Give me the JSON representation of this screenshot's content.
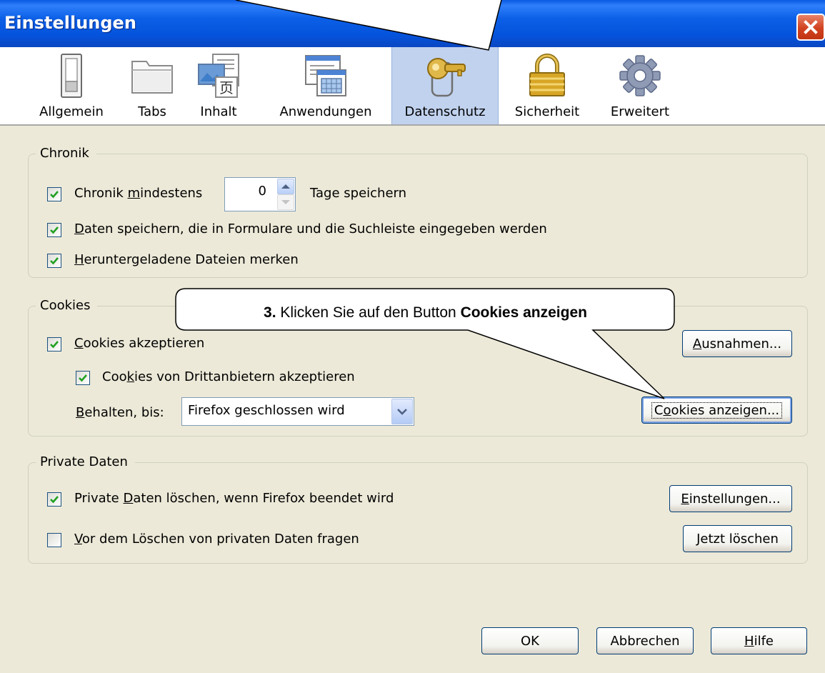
{
  "window": {
    "title": "Einstellungen"
  },
  "toolbar": {
    "items": [
      {
        "label": "Allgemein",
        "icon": "switch-icon",
        "selected": false
      },
      {
        "label": "Tabs",
        "icon": "folder-tab-icon",
        "selected": false
      },
      {
        "label": "Inhalt",
        "icon": "content-image-icon",
        "selected": false
      },
      {
        "label": "Anwendungen",
        "icon": "applications-window-icon",
        "selected": false
      },
      {
        "label": "Datenschutz",
        "icon": "key-privacy-icon",
        "selected": true
      },
      {
        "label": "Sicherheit",
        "icon": "padlock-icon",
        "selected": false
      },
      {
        "label": "Erweitert",
        "icon": "gear-icon",
        "selected": false
      }
    ]
  },
  "history": {
    "title": "Chronik",
    "keep_history": {
      "checked": true,
      "label_pre": "Chronik ",
      "label_access": "m",
      "label_post": "indestens",
      "days_value": "0",
      "days_suffix": "Tage speichern"
    },
    "form_data": {
      "checked": true,
      "label_access": "D",
      "label_post": "aten speichern, die in Formulare und die Suchleiste eingegeben werden"
    },
    "downloads": {
      "checked": true,
      "label_access": "H",
      "label_post": "eruntergeladene Dateien merken"
    }
  },
  "cookies": {
    "title": "Cookies",
    "accept": {
      "checked": true,
      "label_access": "C",
      "label_post": "ookies akzeptieren"
    },
    "third_party": {
      "checked": true,
      "label_pre": "Coo",
      "label_access": "k",
      "label_post": "ies von Drittanbietern akzeptieren"
    },
    "keep_until": {
      "label_access": "B",
      "label_post": "ehalten, bis:",
      "value": "Firefox geschlossen wird"
    },
    "exceptions_button": {
      "label_access": "A",
      "label_post": "usnahmen..."
    },
    "show_cookies_button": {
      "label_pre": "C",
      "label_access": "o",
      "label_post": "okies anzeigen..."
    }
  },
  "private_data": {
    "title": "Private Daten",
    "clear_on_exit": {
      "checked": true,
      "label_pre": "Private ",
      "label_access": "D",
      "label_post": "aten löschen, wenn Firefox beendet wird"
    },
    "ask_before": {
      "checked": false,
      "label_access": "V",
      "label_post": "or dem Löschen von privaten Daten fragen"
    },
    "settings_button": {
      "label_access": "E",
      "label_post": "instellungen..."
    },
    "clear_now_button": {
      "label_access": "J",
      "label_post": "etzt löschen"
    }
  },
  "footer": {
    "ok_label": "OK",
    "cancel_label": "Abbrechen",
    "help_button": {
      "label_access": "H",
      "label_post": "ilfe"
    }
  },
  "callout": {
    "step": "3.",
    "text": " Klicken Sie auf den Button ",
    "bold": "Cookies anzeigen"
  },
  "colors": {
    "titlebar": "#0553dc",
    "dialog_bg": "#ece9d8",
    "selected_tab": "#c1d2ee",
    "close_button": "#d1421f",
    "checkmark": "#21a121"
  }
}
